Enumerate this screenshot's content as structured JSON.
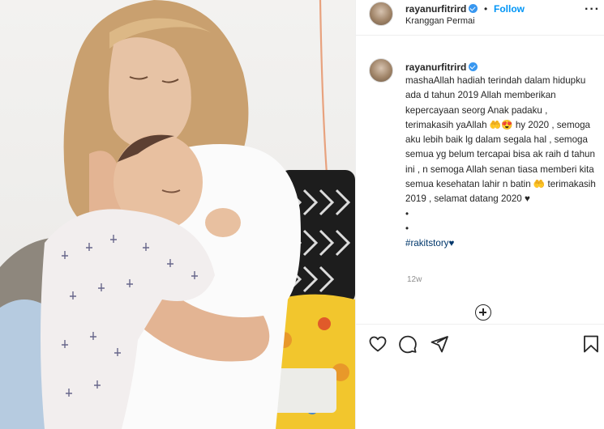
{
  "post": {
    "username": "rayanurfitrird",
    "follow_label": "Follow",
    "separator": "•",
    "more_label": "···",
    "location": "Kranggan Permai"
  },
  "caption": {
    "username": "rayanurfitrird",
    "text": "mashaAllah hadiah terindah dalam hidupku ada d tahun 2019 Allah memberikan kepercayaan seorg Anak padaku , terimakasih yaAllah 🤲😍 hy 2020 , semoga aku lebih baik lg dalam segala hal , semoga semua yg belum tercapai bisa ak raih d tahun ini , n semoga Allah senan tiasa memberi kita semua kesehatan lahir n batin 🤲 terimakasih 2019 , selamat datang 2020 ♥\n•\n•",
    "hashtag": "#rakitstory♥",
    "time_ago": "12w"
  },
  "icons": {
    "verified": "verified-badge-icon",
    "more": "more-options-icon",
    "load_more": "plus-circle-icon",
    "like": "heart-icon",
    "comment": "comment-icon",
    "share": "paper-plane-icon",
    "save": "bookmark-icon"
  },
  "colors": {
    "link_blue": "#0095f6",
    "hashtag_blue": "#00376b",
    "verified_blue": "#3897f0",
    "muted_gray": "#8e8e8e",
    "text": "#262626",
    "border": "#efefef"
  }
}
